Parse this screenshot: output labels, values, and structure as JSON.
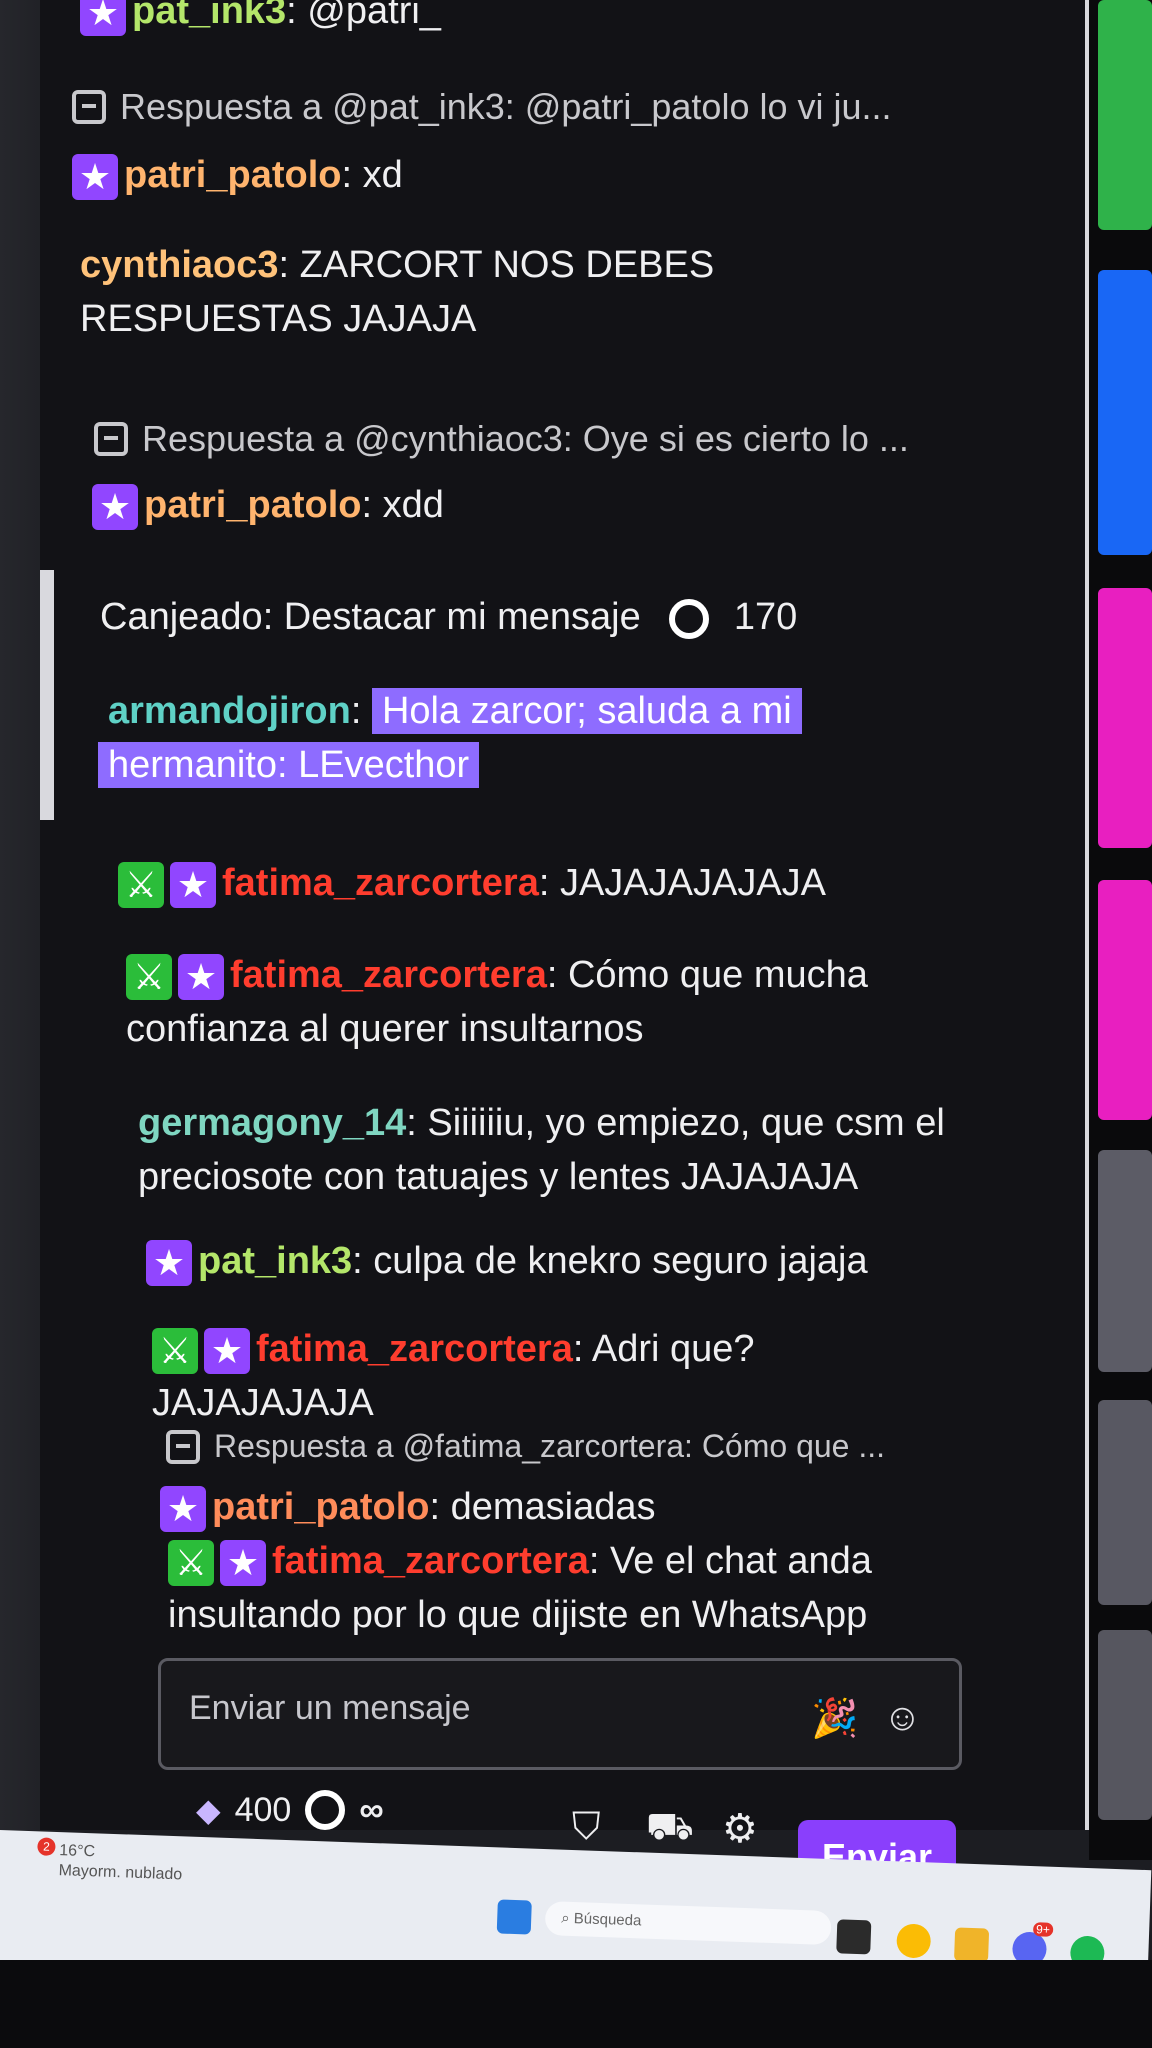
{
  "chat": {
    "messages": [
      {
        "username": "pat_ink3",
        "text": ": @patri_"
      },
      {
        "reply": "Respuesta a @pat_ink3: @patri_patolo lo vi ju...",
        "username": "patri_patolo",
        "text": ": xd"
      },
      {
        "username": "cynthiaoc3",
        "text": ": ZARCORT NOS DEBES",
        "text2": "RESPUESTAS JAJAJA"
      },
      {
        "reply": "Respuesta a @cynthiaoc3: Oye si es cierto lo ...",
        "username": "patri_patolo",
        "text": ": xdd"
      },
      {
        "redeem_label": "Canjeado: Destacar mi mensaje",
        "redeem_cost": "170",
        "username": "armandojiron",
        "text": "Hola zarcor; saluda a mi",
        "text2": "hermanito: LEvecthor"
      },
      {
        "username": "fatima_zarcortera",
        "text": ": JAJAJAJAJAJA"
      },
      {
        "username": "fatima_zarcortera",
        "text": ": Cómo que mucha",
        "text2": "confianza al querer insultarnos"
      },
      {
        "username": "germagony_14",
        "text": ": Siiiiiiu, yo empiezo, que csm el",
        "text2": "preciosote con tatuajes y lentes JAJAJAJA"
      },
      {
        "username": "pat_ink3",
        "text": ": culpa de knekro seguro jajaja"
      },
      {
        "username": "fatima_zarcortera",
        "text": ": Adri que?",
        "text2": "JAJAJAJAJA"
      },
      {
        "reply": "Respuesta a @fatima_zarcortera: Cómo que ...",
        "username": "patri_patolo",
        "text": ": demasiadas"
      },
      {
        "username": "fatima_zarcortera",
        "text": ": Ve el chat anda",
        "text2": "insultando por lo que dijiste en WhatsApp"
      }
    ]
  },
  "input": {
    "placeholder": "Enviar un mensaje"
  },
  "bottom": {
    "bits": "400",
    "points": "∞",
    "send_label": "Enviar"
  },
  "taskbar": {
    "weather_temp": "16°C",
    "weather_desc": "Mayorm. nublado",
    "search_placeholder": "Búsqueda",
    "notification_count": "2",
    "discord_badge": "9+"
  },
  "colors": {
    "twitch_purple": "#9146ff",
    "highlight": "#8e6cff",
    "send_button": "#8a3ffc"
  }
}
